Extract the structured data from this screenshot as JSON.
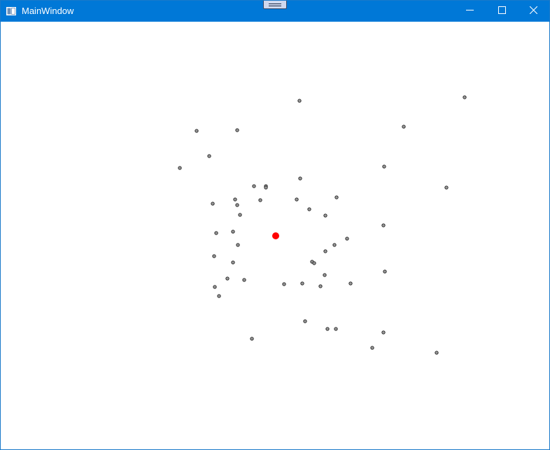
{
  "window": {
    "title": "MainWindow",
    "title_bar_color": "#0078d7",
    "icons": {
      "app": "app-window-icon",
      "minimize": "minimize-icon",
      "maximize": "maximize-icon",
      "close": "close-icon"
    }
  },
  "canvas": {
    "target_color": "#ff0000",
    "dot_fill": "#9a9a9a",
    "dot_stroke": "#222222"
  }
}
